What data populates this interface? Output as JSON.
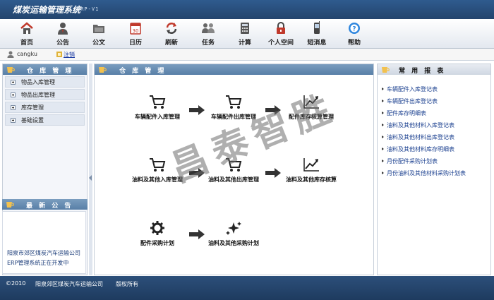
{
  "header": {
    "title": "煤炭运输管理系统",
    "version": "ERP-V1"
  },
  "toolbar": {
    "items": [
      {
        "label": "首页",
        "icon": "home-icon"
      },
      {
        "label": "公告",
        "icon": "person-icon"
      },
      {
        "label": "公文",
        "icon": "folder-icon"
      },
      {
        "label": "日历",
        "icon": "calendar-icon"
      },
      {
        "label": "刷新",
        "icon": "refresh-icon"
      },
      {
        "label": "任务",
        "icon": "users-icon"
      },
      {
        "label": "计算",
        "icon": "calculator-icon"
      },
      {
        "label": "个人空间",
        "icon": "lock-icon"
      },
      {
        "label": "短消息",
        "icon": "phone-icon"
      },
      {
        "label": "帮助",
        "icon": "help-icon"
      }
    ]
  },
  "userbar": {
    "username": "cangku",
    "logout": "注销"
  },
  "sidebar": {
    "title": "仓 库 管 理",
    "items": [
      {
        "label": "物品入库管理"
      },
      {
        "label": "物品出库管理"
      },
      {
        "label": "库存管理"
      },
      {
        "label": "基础设置"
      }
    ]
  },
  "news": {
    "title": "最 新 公 告",
    "text": "阳泉市郊区煤炭汽车运输公司ERP管理系统正在开发中"
  },
  "main": {
    "title": "仓 库 管 理",
    "watermark": "昌泰智胜",
    "flow": {
      "row1": [
        "车辆配件入库管理",
        "车辆配件出库管理",
        "配件库存核算管理"
      ],
      "row2": [
        "油料及其他入库管理",
        "油料及其他出库管理",
        "油料及其他库存核算"
      ],
      "row3": [
        "配件采购计划",
        "油料及其他采购计划"
      ]
    }
  },
  "reports": {
    "title": "常 用 报 表",
    "items": [
      {
        "label": "车辆配件入库登记表"
      },
      {
        "label": "车辆配件出库登记表"
      },
      {
        "label": "配件库存明细表"
      },
      {
        "label": "油料及其他材料入库登记表"
      },
      {
        "label": "油料及其他材料出库登记表"
      },
      {
        "label": "油料及其他材料库存明细表"
      },
      {
        "label": "月份配件采购计划表"
      },
      {
        "label": "月份油料及其他材料采购计划表"
      }
    ]
  },
  "footer": {
    "copyright": "©2010",
    "company": "阳泉郊区煤炭汽车运输公司",
    "rights": "版权所有"
  },
  "colors": {
    "banner": "#2f5b8e",
    "footer": "#23446d",
    "panel_head": "#6a8fb5",
    "link": "#1a3f8f"
  }
}
